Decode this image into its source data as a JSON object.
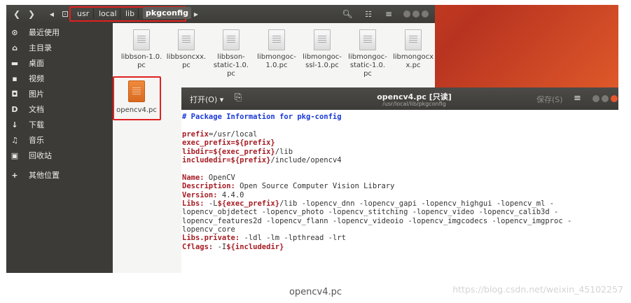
{
  "file_manager": {
    "breadcrumb": [
      "usr",
      "local",
      "lib",
      "pkgconfig"
    ],
    "sidebar": [
      {
        "icon": "clock-icon",
        "glyph": "⊙",
        "label": "最近使用"
      },
      {
        "icon": "home-icon",
        "glyph": "⌂",
        "label": "主目录"
      },
      {
        "icon": "desktop-folder-icon",
        "glyph": "▬",
        "label": "桌面"
      },
      {
        "icon": "video-icon",
        "glyph": "▪",
        "label": "视频"
      },
      {
        "icon": "camera-icon",
        "glyph": "◘",
        "label": "图片"
      },
      {
        "icon": "document-icon",
        "glyph": "D",
        "label": "文档"
      },
      {
        "icon": "download-icon",
        "glyph": "↓",
        "label": "下载"
      },
      {
        "icon": "music-icon",
        "glyph": "♫",
        "label": "音乐"
      },
      {
        "icon": "trash-icon",
        "glyph": "▣",
        "label": "回收站"
      },
      {
        "icon": "plus-icon",
        "glyph": "+",
        "label": "其他位置"
      }
    ],
    "files": [
      {
        "name": "libbson-1.0.pc",
        "lines": [
          "libbson-1.0.",
          "pc"
        ]
      },
      {
        "name": "libbsoncxx.pc",
        "lines": [
          "libbsoncxx.",
          "pc"
        ]
      },
      {
        "name": "libbson-static-1.0.pc",
        "lines": [
          "libbson-",
          "static-1.0.",
          "pc"
        ]
      },
      {
        "name": "libmongoc-1.0.pc",
        "lines": [
          "libmongoc-",
          "1.0.pc"
        ]
      },
      {
        "name": "libmongoc-ssl-1.0.pc",
        "lines": [
          "libmongoc-",
          "ssl-1.0.pc"
        ]
      },
      {
        "name": "libmongoc-static-1.0.pc",
        "lines": [
          "libmongoc-",
          "static-1.0.",
          "pc"
        ]
      },
      {
        "name": "libmongocxx.pc",
        "lines": [
          "libmongocx",
          "x.pc"
        ]
      }
    ],
    "selected_file": "opencv4.pc"
  },
  "editor": {
    "open_label": "打开(O) ▾",
    "title": "opencv4.pc [只读]",
    "subtitle": "/usr/local/lib/pkgconfig",
    "save_label": "保存(S)",
    "lines": [
      [
        {
          "c": "cm",
          "t": "# Package Information for pkg-config"
        }
      ],
      [],
      [
        {
          "c": "kw",
          "t": "prefix"
        },
        {
          "c": "tx",
          "t": "=/usr/local"
        }
      ],
      [
        {
          "c": "kw",
          "t": "exec_prefix=${prefix}"
        }
      ],
      [
        {
          "c": "kw",
          "t": "libdir=${exec_prefix}"
        },
        {
          "c": "tx",
          "t": "/lib"
        }
      ],
      [
        {
          "c": "kw",
          "t": "includedir=${prefix}"
        },
        {
          "c": "tx",
          "t": "/include/opencv4"
        }
      ],
      [],
      [
        {
          "c": "kw",
          "t": "Name:"
        },
        {
          "c": "tx",
          "t": " OpenCV"
        }
      ],
      [
        {
          "c": "kw",
          "t": "Description:"
        },
        {
          "c": "tx",
          "t": " Open Source Computer Vision Library"
        }
      ],
      [
        {
          "c": "kw",
          "t": "Version:"
        },
        {
          "c": "tx",
          "t": " 4.4.0"
        }
      ],
      [
        {
          "c": "kw",
          "t": "Libs:"
        },
        {
          "c": "tx",
          "t": " -L"
        },
        {
          "c": "kw",
          "t": "${exec_prefix}"
        },
        {
          "c": "tx",
          "t": "/lib -lopencv_dnn -lopencv_gapi -lopencv_highgui -lopencv_ml -"
        }
      ],
      [
        {
          "c": "tx",
          "t": "lopencv_objdetect -lopencv_photo -lopencv_stitching -lopencv_video -lopencv_calib3d -"
        }
      ],
      [
        {
          "c": "tx",
          "t": "lopencv_features2d -lopencv_flann -lopencv_videoio -lopencv_imgcodecs -lopencv_imgproc -"
        }
      ],
      [
        {
          "c": "tx",
          "t": "lopencv_core"
        }
      ],
      [
        {
          "c": "kw",
          "t": "Libs.private:"
        },
        {
          "c": "tx",
          "t": " -ldl -lm -lpthread -lrt"
        }
      ],
      [
        {
          "c": "kw",
          "t": "Cflags:"
        },
        {
          "c": "tx",
          "t": " -I"
        },
        {
          "c": "kw",
          "t": "${includedir}"
        }
      ]
    ]
  },
  "caption": "opencv4.pc",
  "watermark": "https://blog.csdn.net/weixin_45102257"
}
